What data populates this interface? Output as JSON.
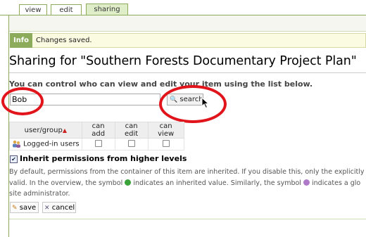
{
  "tabs": [
    {
      "label": "view",
      "active": false
    },
    {
      "label": "edit",
      "active": false
    },
    {
      "label": "sharing",
      "active": true
    }
  ],
  "info": {
    "label": "Info",
    "message": "Changes saved."
  },
  "page": {
    "title": "Sharing for \"Southern Forests Documentary Project Plan\"",
    "intro": "You can control who can view and edit your item using the list below."
  },
  "search": {
    "value": "Bob",
    "button_label": "search"
  },
  "table": {
    "headers": [
      "user/group",
      "can add",
      "can edit",
      "can view"
    ],
    "rows": [
      {
        "name": "Logged-in users",
        "can_add": false,
        "can_edit": false,
        "can_view": false
      }
    ]
  },
  "inherit": {
    "checked": true,
    "label": "Inherit permissions from higher levels",
    "description_lines": [
      "By default, permissions from the container of this item are inherited. If you disable this, only the explicitly",
      "valid. In the overview, the symbol",
      "indicates an inherited value. Similarly, the symbol",
      "indicates a glo",
      "site administrator."
    ]
  },
  "buttons": {
    "save": "save",
    "cancel": "cancel"
  },
  "colors": {
    "accent": "#8cac5c",
    "highlight_ring": "#e0141a",
    "tab_active_bg": "#dfeec8"
  }
}
